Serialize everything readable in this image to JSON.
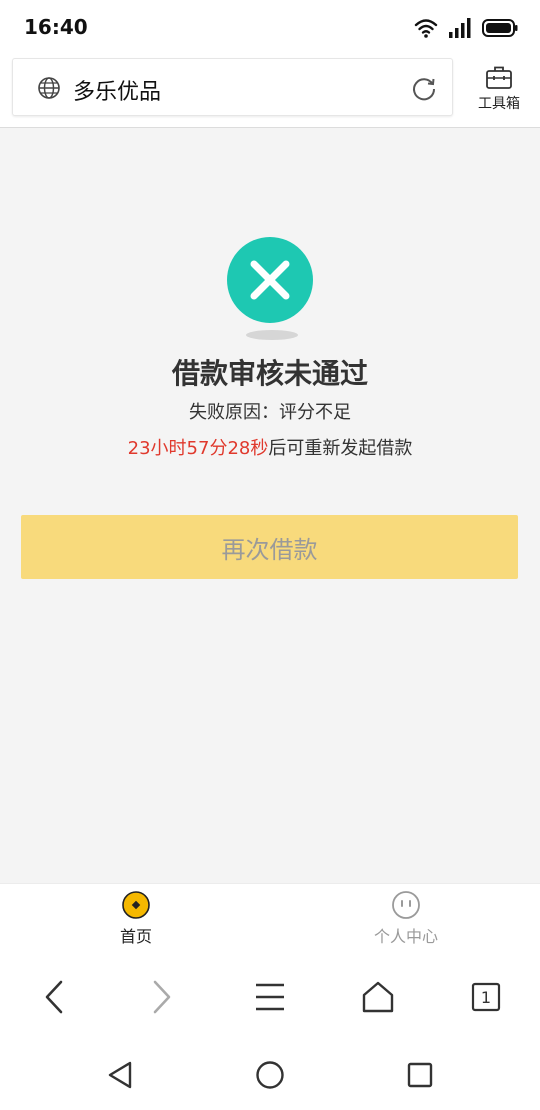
{
  "status_bar": {
    "time": "16:40"
  },
  "browser": {
    "url_title": "多乐优品",
    "toolbox_label": "工具箱",
    "tab_count": "1"
  },
  "result": {
    "title": "借款审核未通过",
    "reason": "失败原因：评分不足",
    "countdown": "23小时57分28秒",
    "countdown_suffix": "后可重新发起借款",
    "retry_label": "再次借款"
  },
  "app_tabs": [
    {
      "label": "首页",
      "active": true
    },
    {
      "label": "个人中心",
      "active": false
    }
  ],
  "colors": {
    "fail_icon": "#1ec8b2",
    "countdown_text": "#e0392d",
    "retry_button": "#f8da7c",
    "active_tab_icon": "#f5b800"
  }
}
